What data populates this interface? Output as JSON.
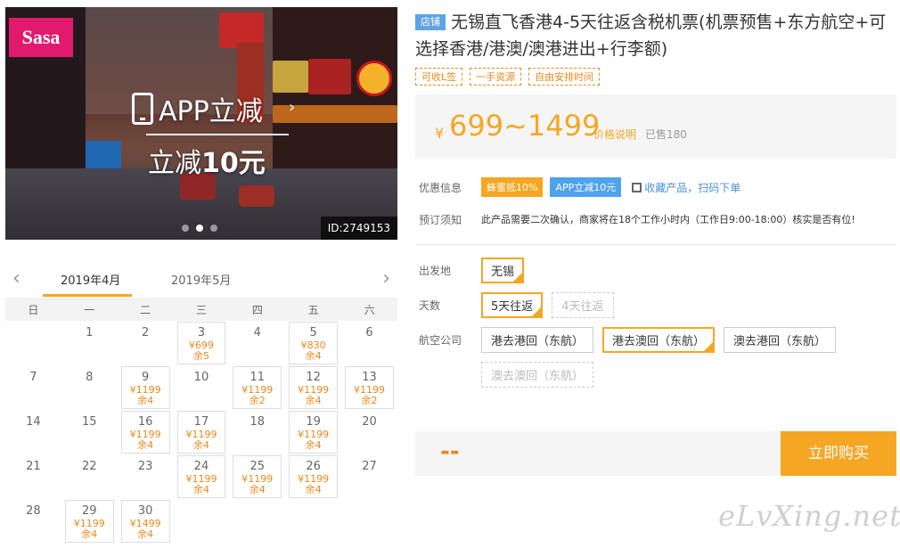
{
  "hero": {
    "logo_text": "Sasa",
    "promo_line1": "APP立减",
    "promo_line2_prefix": "立减",
    "promo_line2_amount": "10元",
    "product_id": "ID:2749153",
    "chevron": "›"
  },
  "calendar": {
    "prev_arrow": "‹",
    "next_arrow": "›",
    "months": [
      "2019年4月",
      "2019年5月"
    ],
    "weekdays": [
      "日",
      "一",
      "二",
      "三",
      "四",
      "五",
      "六"
    ],
    "cells": [
      {
        "d": ""
      },
      {
        "d": "1"
      },
      {
        "d": "2"
      },
      {
        "d": "3",
        "p": "¥699",
        "r": "余5"
      },
      {
        "d": "4"
      },
      {
        "d": "5",
        "p": "¥830",
        "r": "余4"
      },
      {
        "d": "6"
      },
      {
        "d": "7"
      },
      {
        "d": "8"
      },
      {
        "d": "9",
        "p": "¥1199",
        "r": "余4"
      },
      {
        "d": "10"
      },
      {
        "d": "11",
        "p": "¥1199",
        "r": "余2"
      },
      {
        "d": "12",
        "p": "¥1199",
        "r": "余4"
      },
      {
        "d": "13",
        "p": "¥1199",
        "r": "余2"
      },
      {
        "d": "14"
      },
      {
        "d": "15"
      },
      {
        "d": "16",
        "p": "¥1199",
        "r": "余4"
      },
      {
        "d": "17",
        "p": "¥1199",
        "r": "余4"
      },
      {
        "d": "18"
      },
      {
        "d": "19",
        "p": "¥1199",
        "r": "余4"
      },
      {
        "d": "20"
      },
      {
        "d": "21"
      },
      {
        "d": "22"
      },
      {
        "d": "23"
      },
      {
        "d": "24",
        "p": "¥1199",
        "r": "余4"
      },
      {
        "d": "25",
        "p": "¥1199",
        "r": "余4"
      },
      {
        "d": "26",
        "p": "¥1199",
        "r": "余4"
      },
      {
        "d": "27"
      },
      {
        "d": "28"
      },
      {
        "d": "29",
        "p": "¥1199",
        "r": "余4"
      },
      {
        "d": "30",
        "p": "¥1499",
        "r": "余4"
      }
    ]
  },
  "product": {
    "shop_badge": "店铺",
    "title": "无锡直飞香港4-5天往返含税机票(机票预售+东方航空+可选择香港/港澳/澳港进出+行李额)",
    "tags": [
      "可收L签",
      "一手资源",
      "自由安排时间"
    ],
    "price_currency": "¥",
    "price_range": "699~1499",
    "price_note": "价格说明",
    "sold": "已售180"
  },
  "info": {
    "promo_label": "优惠信息",
    "promo_badge1": "蜂蜜抵10%",
    "promo_badge2": "APP立减10元",
    "qr_text": "收藏产品，扫码下单",
    "notice_label": "预订须知",
    "notice_text": "此产品需要二次确认，商家将在18个工作小时内（工作日9:00-18:00）核实是否有位!"
  },
  "options": {
    "departure_label": "出发地",
    "departure": [
      {
        "label": "无锡",
        "state": "sel"
      }
    ],
    "days_label": "天数",
    "days": [
      {
        "label": "5天往返",
        "state": "sel"
      },
      {
        "label": "4天往返",
        "state": "dis"
      }
    ],
    "airline_label": "航空公司",
    "airline": [
      {
        "label": "港去港回（东航）",
        "state": ""
      },
      {
        "label": "港去澳回（东航）",
        "state": "sel"
      },
      {
        "label": "澳去港回（东航）",
        "state": ""
      },
      {
        "label": "澳去澳回（东航）",
        "state": "dis"
      }
    ]
  },
  "buy": {
    "total": "--",
    "button": "立即购买"
  },
  "watermark": "eLvXing.net"
}
